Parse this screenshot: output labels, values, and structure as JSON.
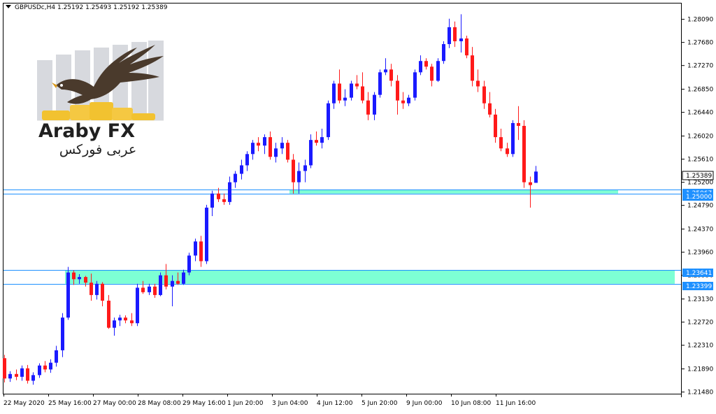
{
  "header": {
    "symbol": "GBPUSDc,H4",
    "ohlc": "1.25192 1.25493 1.25192 1.25389"
  },
  "logo": {
    "brand": "Araby FX",
    "arabic": "عربى فوركس"
  },
  "colors": {
    "bull": "#1a1aff",
    "bear": "#ff1a1a",
    "zone": "#7dffd4",
    "zone_line": "#1e90ff",
    "price_tag": "#1e90ff",
    "current_tag_bg": "#ffffff"
  },
  "price_axis": {
    "ticks": [
      "1.28090",
      "1.27680",
      "1.27270",
      "1.26850",
      "1.26440",
      "1.26020",
      "1.25610",
      "1.25200",
      "1.24790",
      "1.24370",
      "1.23960",
      "1.23550",
      "1.23130",
      "1.22720",
      "1.22310",
      "1.21890",
      "1.21480"
    ]
  },
  "time_axis": {
    "labels": [
      "22 May 2020",
      "25 May 16:00",
      "27 May 00:00",
      "28 May 08:00",
      "29 May 16:00",
      "1 Jun 20:00",
      "3 Jun 04:00",
      "4 Jun 12:00",
      "5 Jun 20:00",
      "9 Jun 00:00",
      "10 Jun 08:00",
      "11 Jun 16:00"
    ]
  },
  "price_tags": {
    "current": "1.25389",
    "level_1": "1.25000",
    "level_1_hidden": "1.25067",
    "zone_top": "1.23641",
    "zone_bottom": "1.23399"
  },
  "chart_data": {
    "type": "candlestick",
    "ylim": [
      1.2145,
      1.2837
    ],
    "zones": [
      {
        "from": 1.23399,
        "to": 1.23641
      },
      {
        "from": 1.25,
        "to": 1.2507
      }
    ],
    "levels": [
      1.25067,
      1.25,
      1.23641,
      1.23399
    ],
    "candles": [
      [
        1.2208,
        1.2214,
        1.2165,
        1.2172
      ],
      [
        1.2172,
        1.2185,
        1.2166,
        1.218
      ],
      [
        1.218,
        1.2188,
        1.2169,
        1.2175
      ],
      [
        1.2175,
        1.2195,
        1.2168,
        1.219
      ],
      [
        1.219,
        1.2196,
        1.2163,
        1.2168
      ],
      [
        1.2168,
        1.2183,
        1.2161,
        1.2178
      ],
      [
        1.2178,
        1.2199,
        1.2173,
        1.2195
      ],
      [
        1.2195,
        1.2203,
        1.2183,
        1.2188
      ],
      [
        1.2188,
        1.2206,
        1.2182,
        1.22
      ],
      [
        1.22,
        1.223,
        1.2193,
        1.2222
      ],
      [
        1.2222,
        1.2288,
        1.221,
        1.228
      ],
      [
        1.228,
        1.237,
        1.2276,
        1.236
      ],
      [
        1.236,
        1.2364,
        1.2338,
        1.2348
      ],
      [
        1.2348,
        1.2357,
        1.234,
        1.2352
      ],
      [
        1.2352,
        1.2354,
        1.2335,
        1.2342
      ],
      [
        1.2342,
        1.2358,
        1.231,
        1.232
      ],
      [
        1.232,
        1.2345,
        1.2312,
        1.234
      ],
      [
        1.234,
        1.2343,
        1.23,
        1.231
      ],
      [
        1.231,
        1.232,
        1.226,
        1.2262
      ],
      [
        1.2262,
        1.228,
        1.2248,
        1.2275
      ],
      [
        1.2275,
        1.2285,
        1.2265,
        1.228
      ],
      [
        1.228,
        1.2284,
        1.227,
        1.2275
      ],
      [
        1.2275,
        1.2288,
        1.2265,
        1.227
      ],
      [
        1.227,
        1.234,
        1.2265,
        1.2333
      ],
      [
        1.2333,
        1.2345,
        1.2322,
        1.2325
      ],
      [
        1.2325,
        1.234,
        1.232,
        1.2335
      ],
      [
        1.2335,
        1.234,
        1.2315,
        1.232
      ],
      [
        1.232,
        1.236,
        1.2318,
        1.2355
      ],
      [
        1.2355,
        1.2375,
        1.233,
        1.2335
      ],
      [
        1.2335,
        1.2355,
        1.23,
        1.2345
      ],
      [
        1.2345,
        1.236,
        1.2338,
        1.234
      ],
      [
        1.234,
        1.2365,
        1.2338,
        1.236
      ],
      [
        1.236,
        1.2395,
        1.2355,
        1.239
      ],
      [
        1.239,
        1.242,
        1.238,
        1.2415
      ],
      [
        1.2415,
        1.2425,
        1.237,
        1.238
      ],
      [
        1.238,
        1.248,
        1.2375,
        1.2475
      ],
      [
        1.2475,
        1.2505,
        1.246,
        1.25
      ],
      [
        1.25,
        1.251,
        1.2485,
        1.249
      ],
      [
        1.249,
        1.25,
        1.248,
        1.2485
      ],
      [
        1.2485,
        1.253,
        1.248,
        1.252
      ],
      [
        1.252,
        1.254,
        1.251,
        1.2535
      ],
      [
        1.2535,
        1.256,
        1.2525,
        1.255
      ],
      [
        1.255,
        1.2575,
        1.254,
        1.257
      ],
      [
        1.257,
        1.2595,
        1.256,
        1.259
      ],
      [
        1.259,
        1.26,
        1.2575,
        1.2585
      ],
      [
        1.2585,
        1.2605,
        1.257,
        1.26
      ],
      [
        1.26,
        1.261,
        1.256,
        1.2565
      ],
      [
        1.2565,
        1.259,
        1.2555,
        1.258
      ],
      [
        1.258,
        1.26,
        1.257,
        1.259
      ],
      [
        1.259,
        1.2595,
        1.2555,
        1.256
      ],
      [
        1.256,
        1.257,
        1.25,
        1.252
      ],
      [
        1.252,
        1.2555,
        1.25,
        1.254
      ],
      [
        1.254,
        1.256,
        1.252,
        1.255
      ],
      [
        1.255,
        1.2605,
        1.2545,
        1.2595
      ],
      [
        1.2595,
        1.261,
        1.2585,
        1.259
      ],
      [
        1.259,
        1.2615,
        1.258,
        1.26
      ],
      [
        1.26,
        1.2665,
        1.2595,
        1.266
      ],
      [
        1.266,
        1.27,
        1.265,
        1.2695
      ],
      [
        1.2695,
        1.272,
        1.266,
        1.2665
      ],
      [
        1.2665,
        1.2685,
        1.2655,
        1.267
      ],
      [
        1.267,
        1.27,
        1.2665,
        1.2695
      ],
      [
        1.2695,
        1.271,
        1.2685,
        1.269
      ],
      [
        1.269,
        1.2715,
        1.266,
        1.2665
      ],
      [
        1.2665,
        1.268,
        1.263,
        1.264
      ],
      [
        1.264,
        1.268,
        1.263,
        1.2675
      ],
      [
        1.2675,
        1.272,
        1.267,
        1.2715
      ],
      [
        1.2715,
        1.274,
        1.271,
        1.272
      ],
      [
        1.272,
        1.273,
        1.269,
        1.27
      ],
      [
        1.27,
        1.271,
        1.264,
        1.2665
      ],
      [
        1.2665,
        1.268,
        1.265,
        1.266
      ],
      [
        1.266,
        1.2675,
        1.2655,
        1.267
      ],
      [
        1.267,
        1.272,
        1.2665,
        1.2715
      ],
      [
        1.2715,
        1.2745,
        1.271,
        1.2735
      ],
      [
        1.2735,
        1.274,
        1.272,
        1.2725
      ],
      [
        1.2725,
        1.273,
        1.269,
        1.27
      ],
      [
        1.27,
        1.274,
        1.2698,
        1.2735
      ],
      [
        1.2735,
        1.277,
        1.273,
        1.2765
      ],
      [
        1.2765,
        1.281,
        1.2758,
        1.2795
      ],
      [
        1.2795,
        1.2805,
        1.276,
        1.277
      ],
      [
        1.277,
        1.2818,
        1.275,
        1.2775
      ],
      [
        1.2775,
        1.278,
        1.274,
        1.2745
      ],
      [
        1.2745,
        1.276,
        1.269,
        1.27
      ],
      [
        1.27,
        1.272,
        1.268,
        1.269
      ],
      [
        1.269,
        1.27,
        1.265,
        1.266
      ],
      [
        1.266,
        1.268,
        1.2635,
        1.264
      ],
      [
        1.264,
        1.265,
        1.259,
        1.26
      ],
      [
        1.26,
        1.2615,
        1.2575,
        1.258
      ],
      [
        1.258,
        1.259,
        1.2565,
        1.257
      ],
      [
        1.257,
        1.263,
        1.2565,
        1.2625
      ],
      [
        1.2625,
        1.2655,
        1.2595,
        1.262
      ],
      [
        1.262,
        1.263,
        1.251,
        1.252
      ],
      [
        1.252,
        1.253,
        1.2475,
        1.2515
      ],
      [
        1.2519,
        1.2549,
        1.2519,
        1.2539
      ]
    ]
  }
}
